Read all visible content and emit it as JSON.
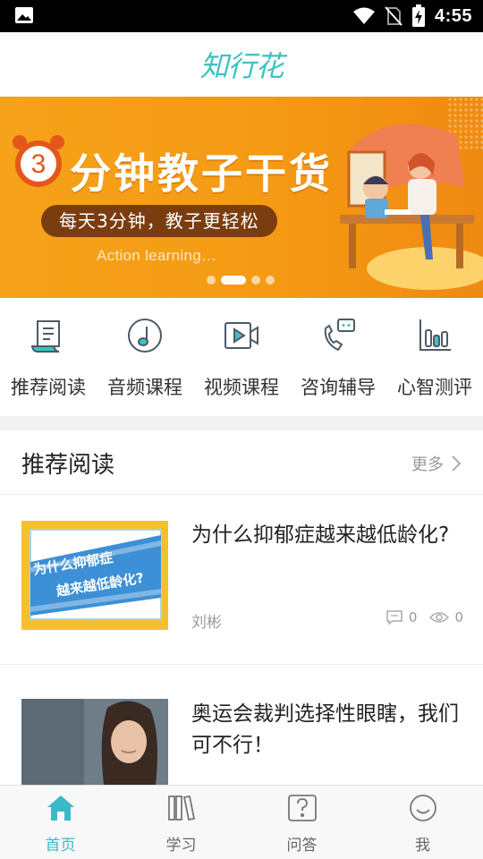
{
  "status_bar": {
    "time": "4:55",
    "icons": [
      "image-icon",
      "wifi-icon",
      "no-sim-icon",
      "battery-charging-icon"
    ]
  },
  "header": {
    "brand": "知行花"
  },
  "banner": {
    "badge_number": "3",
    "title": "分钟教子干货",
    "pill": "每天3分钟，教子更轻松",
    "subtitle": "Action learning…",
    "page_count": 4,
    "active_page": 1
  },
  "categories": [
    {
      "label": "推荐阅读",
      "icon": "scroll-icon"
    },
    {
      "label": "音频课程",
      "icon": "music-note-icon"
    },
    {
      "label": "视频课程",
      "icon": "video-play-icon"
    },
    {
      "label": "咨询辅导",
      "icon": "phone-chat-icon"
    },
    {
      "label": "心智测评",
      "icon": "bar-chart-icon"
    }
  ],
  "section": {
    "title": "推荐阅读",
    "more": "更多"
  },
  "articles": [
    {
      "title": "为什么抑郁症越来越低龄化?",
      "thumb_line1": "为什么抑郁症",
      "thumb_line2": "越来越低龄化?",
      "author": "刘彬",
      "comments": "0",
      "views": "0"
    },
    {
      "title": "奥运会裁判选择性眼瞎，我们可不行！"
    }
  ],
  "tabbar": [
    {
      "label": "首页",
      "icon": "home-icon",
      "active": true
    },
    {
      "label": "学习",
      "icon": "books-icon",
      "active": false
    },
    {
      "label": "问答",
      "icon": "question-icon",
      "active": false
    },
    {
      "label": "我",
      "icon": "smiley-icon",
      "active": false
    }
  ],
  "colors": {
    "brand_teal": "#3cc3c0",
    "banner_orange": "#f59a14",
    "tab_active": "#3cb9c8"
  }
}
